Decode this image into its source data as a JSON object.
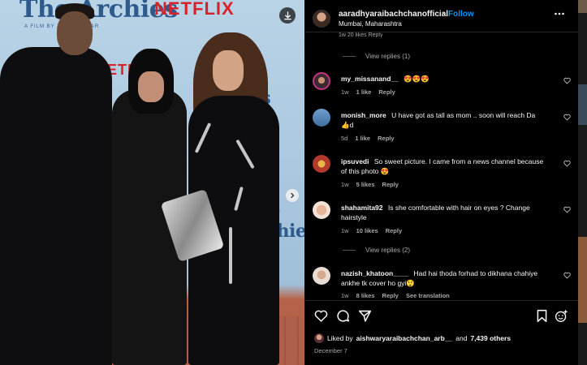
{
  "photo": {
    "bg_title": "The Archies",
    "bg_subtitle": "A FILM BY ZOYA AKHTAR",
    "bg_brand": "NETFLIX",
    "download_icon": "download-icon",
    "next_icon": "chevron-right-icon"
  },
  "header": {
    "username": "aaradhyaraibachchanofficial",
    "separator": "•",
    "follow_label": "Follow",
    "location": "Mumbai, Maharashtra",
    "more_icon": "more-horizontal-icon"
  },
  "partial_row": "1w   20 likes   Reply",
  "comments": [
    {
      "type": "replies",
      "label": "View replies (1)"
    },
    {
      "username": "my_missanand__",
      "text": "😍😍😍",
      "time": "1w",
      "likes": "1 like",
      "reply": "Reply"
    },
    {
      "username": "monish_more",
      "text": "U have got as tall as mom .. soon will reach Da 👍d",
      "time": "5d",
      "likes": "1 like",
      "reply": "Reply"
    },
    {
      "username": "ipsuvedi",
      "text": "So sweet picture. I came from a news channel because of this photo 😍",
      "time": "1w",
      "likes": "5 likes",
      "reply": "Reply"
    },
    {
      "username": "shahamita92",
      "text": "Is she comfortable with hair on eyes ? Change hairstyle",
      "time": "1w",
      "likes": "10 likes",
      "reply": "Reply"
    },
    {
      "type": "replies",
      "label": "View replies (2)"
    },
    {
      "username": "nazish_khatoon____",
      "text": "Had hai thoda forhad to dikhana chahiye ankhe tk cover ho gyi😲",
      "time": "1w",
      "likes": "8 likes",
      "reply": "Reply",
      "translation": "See translation"
    }
  ],
  "actions": {
    "like_icon": "heart-icon",
    "comment_icon": "comment-icon",
    "share_icon": "send-icon",
    "save_icon": "bookmark-icon"
  },
  "liked_by": {
    "prefix": "Liked by",
    "user": "aishwaryaraibachchan_arb__",
    "and": "and",
    "others": "7,439 others"
  },
  "date": "December 7",
  "colors": {
    "accent": "#0095f6",
    "background": "#000000",
    "text": "#f5f5f5",
    "muted": "#a8a8a8"
  }
}
